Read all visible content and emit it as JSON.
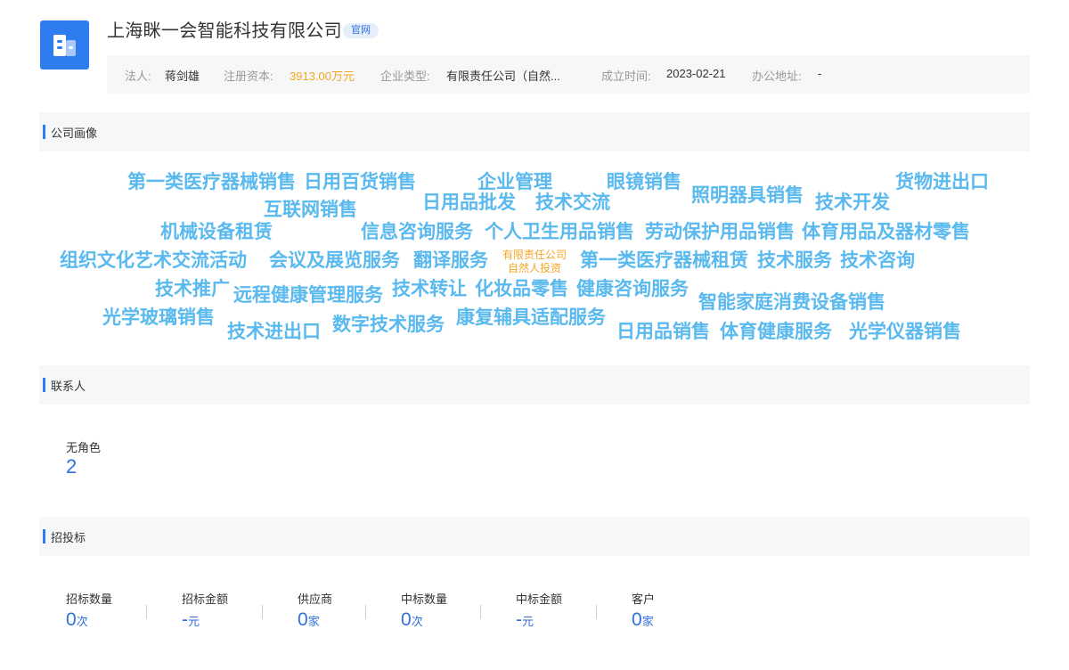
{
  "company": {
    "name": "上海眯一会智能科技有限公司",
    "official_tag": "官网",
    "logo_icon": "building-icon",
    "accent_color": "#2f7bf0"
  },
  "info": {
    "legal_rep_label": "法人:",
    "legal_rep": "蒋剑雄",
    "capital_label": "注册资本:",
    "capital": "3913.00万元",
    "type_label": "企业类型:",
    "type": "有限责任公司（自然...",
    "founded_label": "成立时间:",
    "founded": "2023-02-21",
    "address_label": "办公地址:",
    "address": "-"
  },
  "portrait": {
    "title": "公司画像",
    "center_line1": "有限责任公司",
    "center_line2": "自然人投资",
    "words": [
      "第一类医疗器械销售",
      "日用百货销售",
      "企业管理",
      "眼镜销售",
      "照明器具销售",
      "货物进出口",
      "互联网销售",
      "日用品批发",
      "技术交流",
      "技术开发",
      "机械设备租赁",
      "信息咨询服务",
      "个人卫生用品销售",
      "劳动保护用品销售",
      "体育用品及器材零售",
      "组织文化艺术交流活动",
      "会议及展览服务",
      "翻译服务",
      "第一类医疗器械租赁",
      "技术服务",
      "技术咨询",
      "技术推广",
      "远程健康管理服务",
      "技术转让",
      "化妆品零售",
      "健康咨询服务",
      "智能家庭消费设备销售",
      "光学玻璃销售",
      "技术进出口",
      "数字技术服务",
      "康复辅具适配服务",
      "日用品销售",
      "体育健康服务",
      "光学仪器销售"
    ]
  },
  "contacts": {
    "title": "联系人",
    "role_label": "无角色",
    "count": "2"
  },
  "bidding": {
    "title": "招投标",
    "stats": [
      {
        "label": "招标数量",
        "value": "0",
        "unit": "次"
      },
      {
        "label": "招标金额",
        "value": "-",
        "unit": "元"
      },
      {
        "label": "供应商",
        "value": "0",
        "unit": "家"
      },
      {
        "label": "中标数量",
        "value": "0",
        "unit": "次"
      },
      {
        "label": "中标金额",
        "value": "-",
        "unit": "元"
      },
      {
        "label": "客户",
        "value": "0",
        "unit": "家"
      }
    ]
  }
}
